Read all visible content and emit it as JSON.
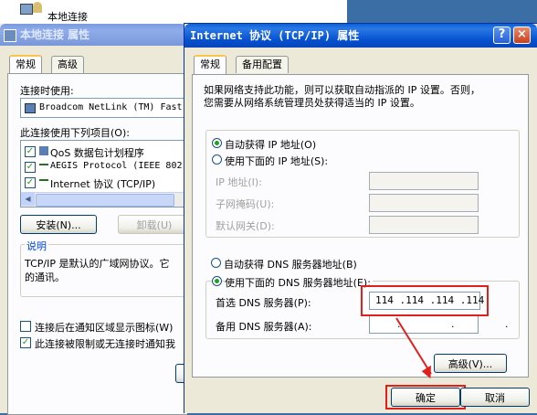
{
  "background_window": {
    "title": "本地连接"
  },
  "left_dialog": {
    "title": "本地连接 属性",
    "tabs": [
      "常规",
      "高级"
    ],
    "connect_using_label": "连接时使用:",
    "adapter_name": "Broadcom NetLink (TM) Fast",
    "items_label": "此连接使用下列项目(O):",
    "items": [
      {
        "label": "QoS 数据包计划程序",
        "checked": true
      },
      {
        "label": "AEGIS Protocol (IEEE 802",
        "checked": true
      },
      {
        "label": "Internet 协议 (TCP/IP)",
        "checked": true
      }
    ],
    "install_button": "安装(N)...",
    "uninstall_button": "卸载(U)",
    "description_title": "说明",
    "description_text_1": "TCP/IP 是默认的广域网协议。它",
    "description_text_2": "的通讯。",
    "show_icon_label": "连接后在通知区域显示图标(W)",
    "notify_label": "此连接被限制或无连接时通知我",
    "show_icon_checked": false,
    "notify_checked": true
  },
  "right_dialog": {
    "title": "Internet 协议 (TCP/IP) 属性",
    "help_button": "?",
    "close_button": "×",
    "tabs": [
      "常规",
      "备用配置"
    ],
    "intro_line_1": "如果网络支持此功能，则可以获取自动指派的 IP 设置。否则，",
    "intro_line_2": "您需要从网络系统管理员处获得适当的 IP 设置。",
    "auto_ip_label": "自动获得 IP 地址(O)",
    "manual_ip_label": "使用下面的 IP 地址(S):",
    "ip_address_label": "IP 地址(I):",
    "subnet_label": "子网掩码(U):",
    "gateway_label": "默认网关(D):",
    "auto_dns_label": "自动获得 DNS 服务器地址(B)",
    "manual_dns_label": "使用下面的 DNS 服务器地址(E):",
    "preferred_dns_label": "首选 DNS 服务器(P):",
    "alternate_dns_label": "备用 DNS 服务器(A):",
    "preferred_dns_value": "114 .114 .114 .114",
    "alternate_dns_value": ". . .",
    "advanced_button": "高级(V)...",
    "ok_button": "确定",
    "cancel_button": "取消",
    "highlight_color": "#e0201b"
  }
}
